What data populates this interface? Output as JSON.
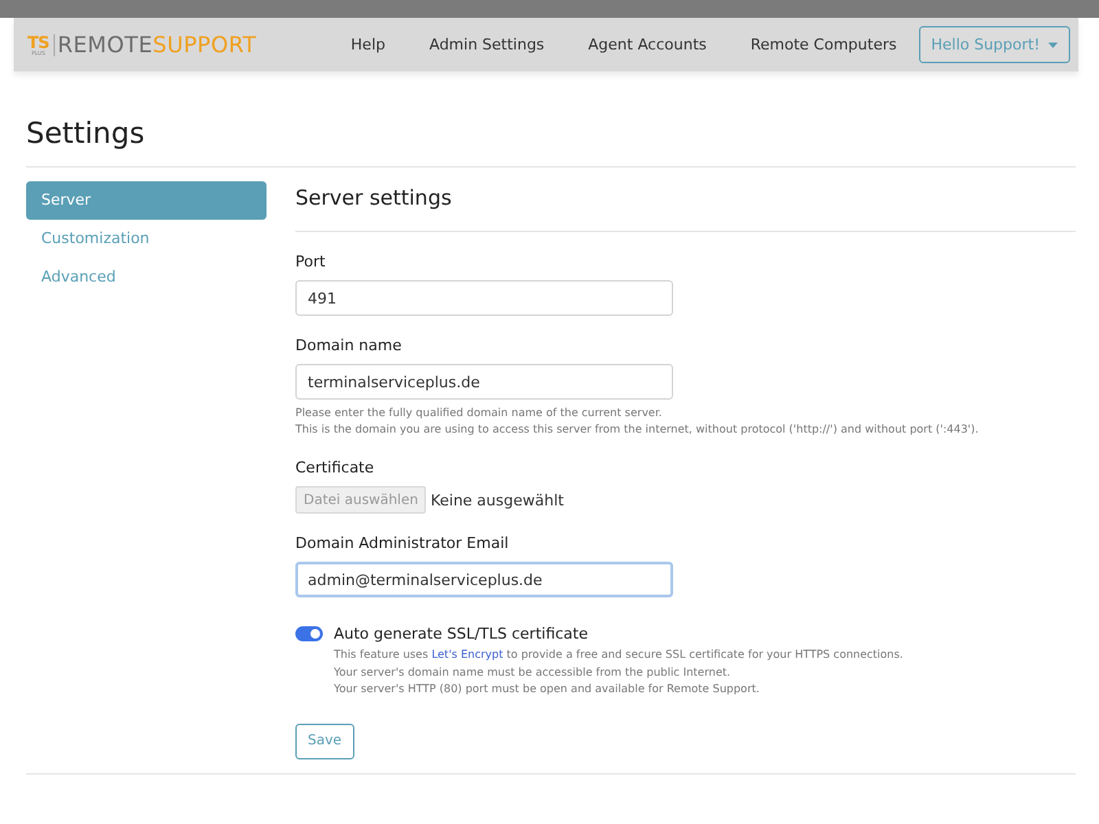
{
  "navbar": {
    "logo": {
      "ts": "TS",
      "plus": "PLUS",
      "remote": "REMOTE",
      "support": "SUPPORT"
    },
    "links": [
      {
        "label": "Help"
      },
      {
        "label": "Admin Settings"
      },
      {
        "label": "Agent Accounts"
      },
      {
        "label": "Remote Computers"
      }
    ],
    "user_menu": {
      "label": "Hello Support!"
    }
  },
  "page_title": "Settings",
  "sidebar": {
    "items": [
      {
        "label": "Server",
        "selected": true
      },
      {
        "label": "Customization",
        "selected": false
      },
      {
        "label": "Advanced",
        "selected": false
      }
    ]
  },
  "section_title": "Server settings",
  "fields": [
    {
      "kind": "text",
      "label": "Port",
      "value": "491",
      "focused": false
    },
    {
      "kind": "text",
      "label": "Domain name",
      "value": "terminalserviceplus.de",
      "focused": false,
      "help": [
        "Please enter the fully qualified domain name of the current server.",
        "This is the domain you are using to access this server from the internet, without protocol ('http://') and without port (':443')."
      ]
    },
    {
      "kind": "file",
      "label": "Certificate",
      "button": "Datei auswählen",
      "status": "Keine ausgewählt"
    },
    {
      "kind": "text",
      "label": "Domain Administrator Email",
      "value": "admin@terminalserviceplus.de",
      "focused": true
    }
  ],
  "ssl_toggle": {
    "label": "Auto generate SSL/TLS certificate",
    "on": true,
    "intro": {
      "before": "This feature uses ",
      "link": "Let's Encrypt",
      "after": " to provide a free and secure SSL certificate for your HTTPS connections."
    },
    "notes": [
      "Your server's domain name must be accessible from the public Internet.",
      "Your server's HTTP (80) port must be open and available for Remote Support."
    ]
  },
  "save_button": "Save"
}
